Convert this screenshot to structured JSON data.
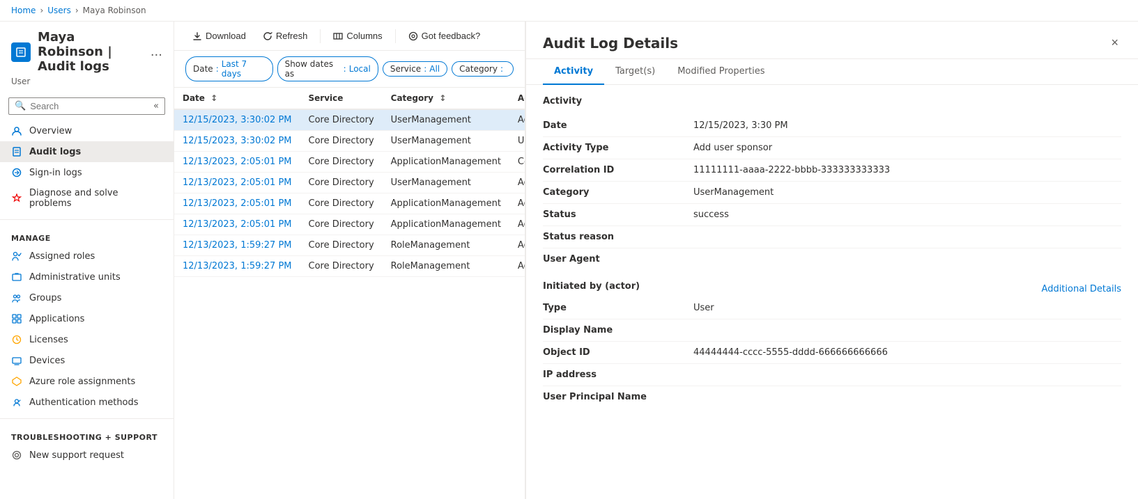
{
  "breadcrumb": {
    "items": [
      "Home",
      "Users",
      "Maya Robinson"
    ]
  },
  "page": {
    "title": "Maya Robinson | Audit logs",
    "subtitle": "User",
    "dots_label": "...",
    "icon_letter": "M"
  },
  "sidebar": {
    "search_placeholder": "Search",
    "collapse_title": "Collapse",
    "nav_items": [
      {
        "label": "Overview",
        "icon": "overview-icon",
        "active": false
      },
      {
        "label": "Audit logs",
        "icon": "auditlogs-icon",
        "active": true
      },
      {
        "label": "Sign-in logs",
        "icon": "signinlogs-icon",
        "active": false
      },
      {
        "label": "Diagnose and solve problems",
        "icon": "diagnose-icon",
        "active": false
      }
    ],
    "manage_section": "Manage",
    "manage_items": [
      {
        "label": "Assigned roles",
        "icon": "assignedroles-icon"
      },
      {
        "label": "Administrative units",
        "icon": "adminunits-icon"
      },
      {
        "label": "Groups",
        "icon": "groups-icon"
      },
      {
        "label": "Applications",
        "icon": "applications-icon"
      },
      {
        "label": "Licenses",
        "icon": "licenses-icon"
      },
      {
        "label": "Devices",
        "icon": "devices-icon"
      },
      {
        "label": "Azure role assignments",
        "icon": "azureroles-icon"
      },
      {
        "label": "Authentication methods",
        "icon": "authmethods-icon"
      }
    ],
    "troubleshooting_section": "Troubleshooting + Support",
    "support_items": [
      {
        "label": "New support request",
        "icon": "support-icon"
      }
    ]
  },
  "toolbar": {
    "download_label": "Download",
    "refresh_label": "Refresh",
    "columns_label": "Columns",
    "feedback_label": "Got feedback?"
  },
  "filters": [
    {
      "key": "Date",
      "value": "Last 7 days"
    },
    {
      "key": "Show dates as",
      "value": "Local"
    },
    {
      "key": "Service",
      "value": "All"
    },
    {
      "key": "Category",
      "value": ""
    }
  ],
  "table": {
    "columns": [
      {
        "label": "Date",
        "sortable": true
      },
      {
        "label": "Service",
        "sortable": false
      },
      {
        "label": "Category",
        "sortable": true
      },
      {
        "label": "Activity",
        "sortable": false
      }
    ],
    "rows": [
      {
        "date": "12/15/2023, 3:30:02 PM",
        "service": "Core Directory",
        "category": "UserManagement",
        "activity": "Add...",
        "selected": true
      },
      {
        "date": "12/15/2023, 3:30:02 PM",
        "service": "Core Directory",
        "category": "UserManagement",
        "activity": "Upda...",
        "selected": false
      },
      {
        "date": "12/13/2023, 2:05:01 PM",
        "service": "Core Directory",
        "category": "ApplicationManagement",
        "activity": "Cons...",
        "selected": false
      },
      {
        "date": "12/13/2023, 2:05:01 PM",
        "service": "Core Directory",
        "category": "UserManagement",
        "activity": "Add...",
        "selected": false
      },
      {
        "date": "12/13/2023, 2:05:01 PM",
        "service": "Core Directory",
        "category": "ApplicationManagement",
        "activity": "Add...",
        "selected": false
      },
      {
        "date": "12/13/2023, 2:05:01 PM",
        "service": "Core Directory",
        "category": "ApplicationManagement",
        "activity": "Add...",
        "selected": false
      },
      {
        "date": "12/13/2023, 1:59:27 PM",
        "service": "Core Directory",
        "category": "RoleManagement",
        "activity": "Add...",
        "selected": false
      },
      {
        "date": "12/13/2023, 1:59:27 PM",
        "service": "Core Directory",
        "category": "RoleManagement",
        "activity": "Add...",
        "selected": false
      }
    ]
  },
  "detail_panel": {
    "title": "Audit Log Details",
    "close_label": "×",
    "tabs": [
      {
        "label": "Activity",
        "active": true
      },
      {
        "label": "Target(s)",
        "active": false
      },
      {
        "label": "Modified Properties",
        "active": false
      }
    ],
    "activity_section_title": "Activity",
    "fields": [
      {
        "label": "Date",
        "value": "12/15/2023, 3:30 PM"
      },
      {
        "label": "Activity Type",
        "value": "Add user sponsor"
      },
      {
        "label": "Correlation ID",
        "value": "11111111-aaaa-2222-bbbb-333333333333"
      },
      {
        "label": "Category",
        "value": "UserManagement"
      },
      {
        "label": "Status",
        "value": "success"
      },
      {
        "label": "Status reason",
        "value": ""
      },
      {
        "label": "User Agent",
        "value": ""
      }
    ],
    "actor_section_title": "Initiated by (actor)",
    "additional_details_label": "Additional Details",
    "actor_fields": [
      {
        "label": "Type",
        "value": "User"
      },
      {
        "label": "Display Name",
        "value": ""
      },
      {
        "label": "Object ID",
        "value": "44444444-cccc-5555-dddd-666666666666"
      },
      {
        "label": "IP address",
        "value": ""
      },
      {
        "label": "User Principal Name",
        "value": ""
      }
    ]
  },
  "colors": {
    "accent": "#0078d4",
    "border": "#edebe9",
    "hover": "#f3f2f1",
    "selected": "#deecf9"
  }
}
